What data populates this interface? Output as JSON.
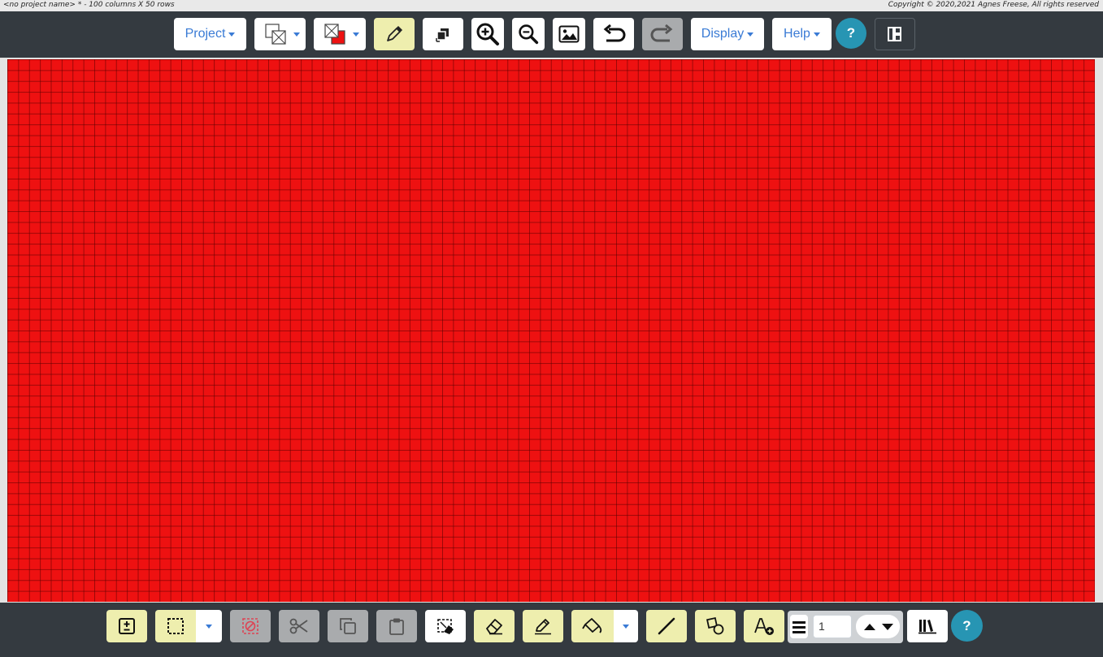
{
  "titlebar": {
    "left": "<no project name> * - 100 columns X 50 rows",
    "right": "Copyright © 2020,2021 Agnes Freese, All rights reserved"
  },
  "top_toolbar": {
    "project_label": "Project",
    "display_label": "Display",
    "help_label": "Help",
    "help_button": "?"
  },
  "bottom_toolbar": {
    "help_button": "?",
    "line_width_value": "1"
  },
  "canvas": {
    "columns": 100,
    "rows": 50,
    "fill_color": "#ee1111"
  },
  "colors": {
    "toolbar_bg": "#343a40",
    "active_tool": "#eeeeae",
    "disabled": "#a9abad",
    "help": "#2795b3",
    "link": "#3a7bd5"
  }
}
